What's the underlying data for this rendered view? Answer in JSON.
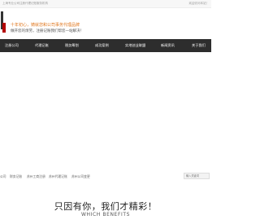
{
  "topbar": {
    "left_text": "上海专业公司注册代理记账服务机构",
    "right_text": "欢迎访问本站！"
  },
  "header": {
    "logo_name": "logo-mark",
    "slogan_line1": "十年初心，铸就您和公司事务代理品牌",
    "slogan_line2": "做开您的烦劳，注册记账我们帮您一站解决！"
  },
  "nav": {
    "items": [
      {
        "label": "注册公司"
      },
      {
        "label": "代理记账"
      },
      {
        "label": "税务筹划"
      },
      {
        "label": "成功案例"
      },
      {
        "label": "实地创业联盟"
      },
      {
        "label": "新闻资讯"
      },
      {
        "label": "关于我们"
      }
    ]
  },
  "breadcrumbs": {
    "items": [
      {
        "label": "公司"
      },
      {
        "label": "财务记账"
      },
      {
        "label": "苏州工商注册"
      },
      {
        "label": "苏州代理记账"
      },
      {
        "label": "苏州公司变更"
      }
    ]
  },
  "search": {
    "placeholder": "输入关键词"
  },
  "benefits": {
    "title": "只因有你，我们才精彩！",
    "subtitle": "WHICH BENEFITS"
  }
}
